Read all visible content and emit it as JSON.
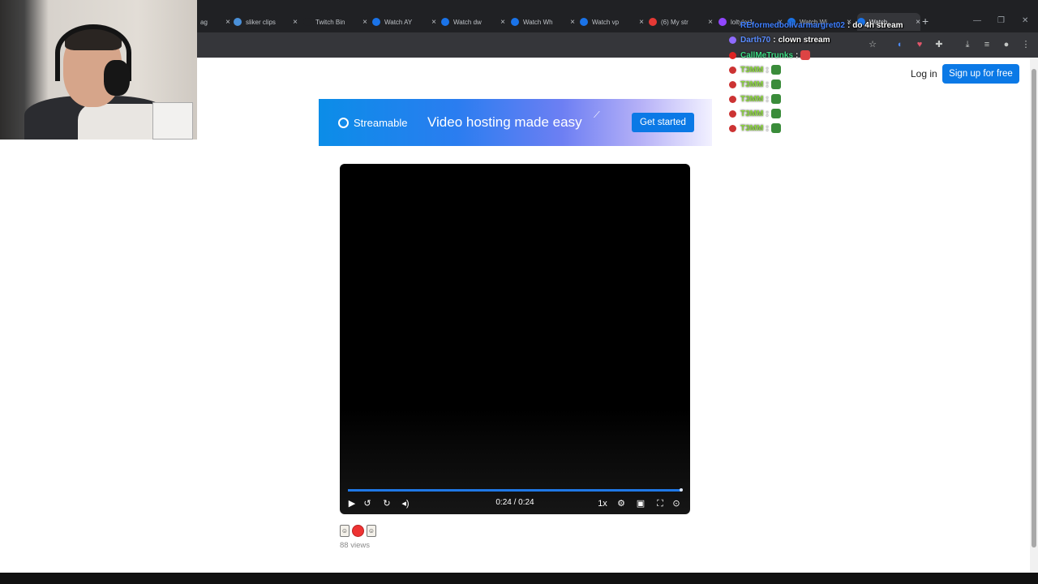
{
  "browser": {
    "tabs": [
      {
        "label": "ag",
        "favicon_color": "#3c4043"
      },
      {
        "label": "sliker clips",
        "favicon_color": "#4a90d9"
      },
      {
        "label": "Twitch Bin",
        "favicon_color": "#202124"
      },
      {
        "label": "Watch AY",
        "favicon_color": "#1a73e8"
      },
      {
        "label": "Watch dw",
        "favicon_color": "#1a73e8"
      },
      {
        "label": "Watch Wh",
        "favicon_color": "#1a73e8"
      },
      {
        "label": "Watch vp",
        "favicon_color": "#1a73e8"
      },
      {
        "label": "(6) My str",
        "favicon_color": "#e53935"
      },
      {
        "label": "loltyler1",
        "favicon_color": "#9146ff"
      },
      {
        "label": "Watch Wi",
        "favicon_color": "#1a73e8"
      },
      {
        "label": "Watch",
        "favicon_color": "#1a73e8"
      }
    ],
    "new_tab_label": "+",
    "close_glyph": "×"
  },
  "chat": [
    {
      "user": "REformedbolivarmargret02",
      "text": "do 4h stream",
      "color": "#3d7eff",
      "badge_color": "",
      "emote": false
    },
    {
      "user": "Darth70",
      "text": "clown stream",
      "color": "#5b8dff",
      "badge_color": "#8f6bff",
      "emote": false
    },
    {
      "user": "CallMeTrunks",
      "text": "",
      "color": "#3ddc84",
      "badge_color": "#d22",
      "emote": true,
      "emote_color": "#d44"
    },
    {
      "user": "T3MM",
      "text": "",
      "color": "#8bd83a",
      "badge_color": "#c33",
      "emote": true,
      "emote_color": "#3a8c3a"
    },
    {
      "user": "T3MM",
      "text": "",
      "color": "#8bd83a",
      "badge_color": "#c33",
      "emote": true,
      "emote_color": "#3a8c3a"
    },
    {
      "user": "T3MM",
      "text": "",
      "color": "#8bd83a",
      "badge_color": "#c33",
      "emote": true,
      "emote_color": "#3a8c3a"
    },
    {
      "user": "T3MM",
      "text": "",
      "color": "#8bd83a",
      "badge_color": "#c33",
      "emote": true,
      "emote_color": "#3a8c3a"
    },
    {
      "user": "T3MM",
      "text": "",
      "color": "#8bd83a",
      "badge_color": "#c33",
      "emote": true,
      "emote_color": "#3a8c3a"
    }
  ],
  "header": {
    "login_label": "Log in",
    "signup_label": "Sign up for free"
  },
  "banner": {
    "brand": "Streamable",
    "tagline": "Video hosting made easy",
    "cta_label": "Get started"
  },
  "player": {
    "time_readout": "0:24 / 0:24",
    "progress": 1.0,
    "speed_label": "1x",
    "accent_color": "#1f78e6"
  },
  "video": {
    "views_label": "88 views"
  }
}
